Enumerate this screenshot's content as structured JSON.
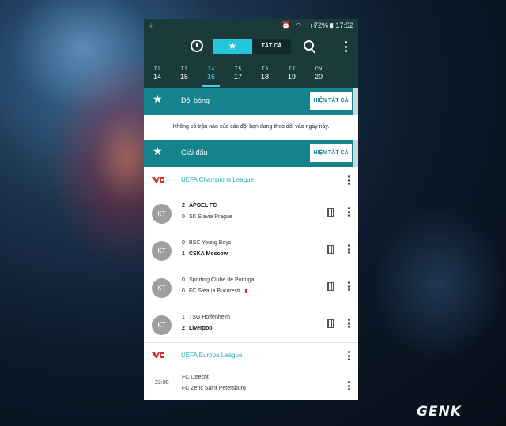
{
  "status": {
    "time": "17:52",
    "battery": "72%"
  },
  "topbar": {
    "tab_all": "TẤT CẢ"
  },
  "days": [
    {
      "wd": "T.2",
      "num": "14"
    },
    {
      "wd": "T.3",
      "num": "15"
    },
    {
      "wd": "T.4",
      "num": "16",
      "active": true
    },
    {
      "wd": "T.5",
      "num": "17"
    },
    {
      "wd": "T.6",
      "num": "18"
    },
    {
      "wd": "T.7",
      "num": "19"
    },
    {
      "wd": "CN",
      "num": "20"
    }
  ],
  "teams_section": {
    "title": "Đội bóng",
    "button": "HIỆN TẤT CẢ",
    "notice": "Không có trận nào của các đội bạn đang theo dõi vào ngày này."
  },
  "leagues_section": {
    "title": "Giải đấu",
    "button": "HIỆN TẤT CẢ"
  },
  "champions_league": {
    "name": "UEFA Champions League",
    "matches": [
      {
        "status": "KT",
        "home": "APOEL FC",
        "home_score": "2",
        "away": "SK Slavia Prague",
        "away_score": "0",
        "winner": "home"
      },
      {
        "status": "KT",
        "home": "BSC Young Boys",
        "home_score": "0",
        "away": "CSKA Moscow",
        "away_score": "1",
        "winner": "away"
      },
      {
        "status": "KT",
        "home": "Sporting Clube de Portugal",
        "home_score": "0",
        "away": "FC Steaua Bucuresti",
        "away_score": "0",
        "winner": "none",
        "away_red_card": true
      },
      {
        "status": "KT",
        "home": "TSG Hoffenheim",
        "home_score": "1",
        "away": "Liverpool",
        "away_score": "2",
        "winner": "away"
      }
    ]
  },
  "europa_league": {
    "name": "UEFA Europa League",
    "matches": [
      {
        "time": "23:00",
        "home": "FC Utrecht",
        "away": "FC Zenit Saint Petersburg"
      }
    ]
  },
  "colors": {
    "teal_dark": "#1b3a3a",
    "teal_header": "#14838c",
    "accent": "#26c6da",
    "link": "#21b1c4"
  },
  "watermark": "GENK"
}
